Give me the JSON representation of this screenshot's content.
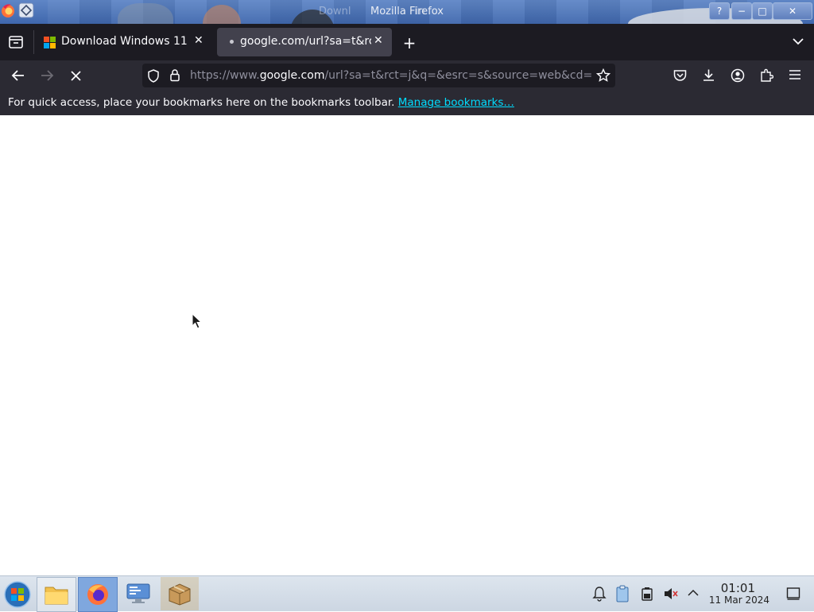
{
  "window": {
    "title": "Mozilla Firefox",
    "title_ghost": "Downl",
    "title_ghost_tail": "in",
    "help_label": "?",
    "minimize_label": "−",
    "maximize_label": "□",
    "close_label": "✕"
  },
  "tabs": [
    {
      "label": "Download Windows 11",
      "icon": "windows-logo-icon",
      "active": false
    },
    {
      "label": "google.com/url?sa=t&rct",
      "icon": "loading-dot-icon",
      "active": true
    }
  ],
  "tabbar": {
    "new_tab_label": "+",
    "list_tabs_label": "⌄"
  },
  "navbar": {
    "url_prefix": "https://www.",
    "url_host": "google.com",
    "url_rest": "/url?sa=t&rct=j&q=&esrc=s&source=web&cd="
  },
  "bookmarks_bar": {
    "message": "For quick access, place your bookmarks here on the bookmarks toolbar.",
    "link_label": "Manage bookmarks…"
  },
  "taskbar": {
    "apps": [
      "start-orb-icon",
      "file-manager-icon",
      "firefox-icon",
      "system-settings-icon",
      "package-archive-icon"
    ],
    "tray": [
      "notification-bell-icon",
      "clipboard-icon",
      "battery-icon",
      "volume-muted-icon",
      "tray-expand-icon",
      "show-desktop-icon"
    ],
    "time": "01:01",
    "date": "11 Mar 2024"
  },
  "colors": {
    "tabbar_bg": "#1c1b22",
    "toolbar_bg": "#2b2a33",
    "link": "#00ddff",
    "active_tab_bg": "#42414d"
  }
}
